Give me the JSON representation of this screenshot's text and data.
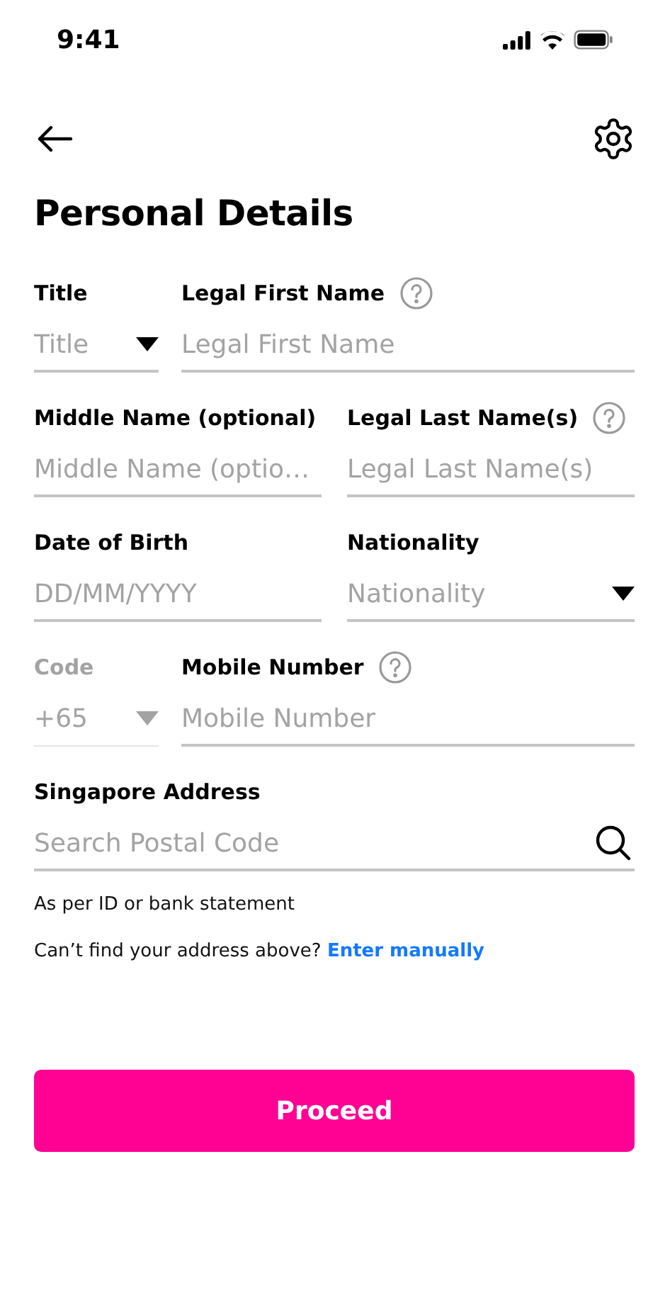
{
  "status_bar": {
    "time": "9:41"
  },
  "header": {
    "title": "Personal Details"
  },
  "rows": [
    [
      {
        "label": "Title",
        "placeholder": "Title",
        "kind": "select",
        "help": false,
        "disabled": false
      },
      {
        "label": "Legal First Name",
        "placeholder": "Legal First Name",
        "kind": "text",
        "help": true,
        "disabled": false
      }
    ],
    [
      {
        "label": "Middle Name (optional)",
        "placeholder": "Middle Name (optio…",
        "kind": "text",
        "help": false,
        "disabled": false
      },
      {
        "label": "Legal Last Name(s)",
        "placeholder": "Legal Last Name(s)",
        "kind": "text",
        "help": true,
        "disabled": false
      }
    ],
    [
      {
        "label": "Date of Birth",
        "placeholder": "DD/MM/YYYY",
        "kind": "text",
        "help": false,
        "disabled": false
      },
      {
        "label": "Nationality",
        "placeholder": "Nationality",
        "kind": "select",
        "help": false,
        "disabled": false
      }
    ],
    [
      {
        "label": "Code",
        "placeholder": "+65",
        "kind": "select",
        "help": false,
        "disabled": true
      },
      {
        "label": "Mobile Number",
        "placeholder": "Mobile Number",
        "kind": "text",
        "help": true,
        "disabled": false
      }
    ]
  ],
  "address": {
    "label": "Singapore Address",
    "placeholder": "Search Postal Code",
    "hint": "As per ID or bank statement",
    "manual_prompt": "Can’t find your address above?",
    "manual_link": "Enter manually"
  },
  "button": "Proceed"
}
